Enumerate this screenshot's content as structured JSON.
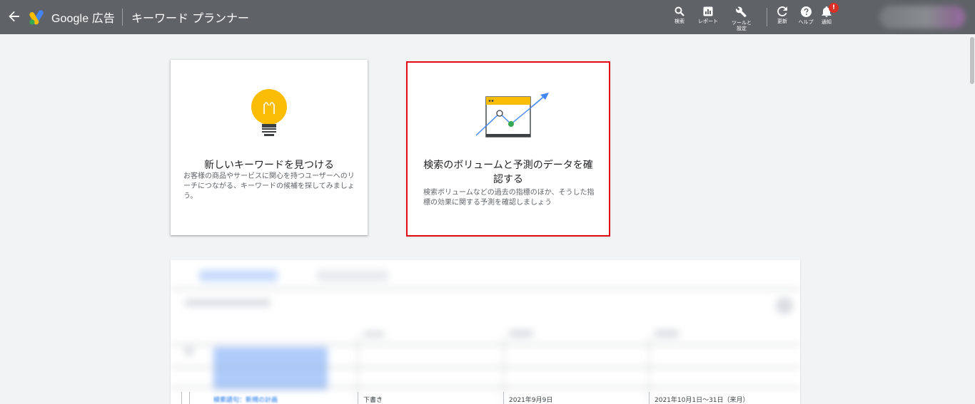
{
  "header": {
    "back_icon": "arrow-left-icon",
    "brand": "Google 広告",
    "page_title": "キーワード プランナー",
    "colors": {
      "bar": "#5f6368",
      "badge": "#d93025"
    },
    "tools": [
      {
        "label": "検索",
        "icon": "search-icon"
      },
      {
        "label": "レポート",
        "icon": "report-icon"
      },
      {
        "label": "ツールと\n設定",
        "icon": "wrench-icon"
      },
      {
        "label": "更新",
        "icon": "refresh-icon"
      },
      {
        "label": "ヘルプ",
        "icon": "help-icon"
      },
      {
        "label": "通知",
        "icon": "bell-icon",
        "badge": "!"
      }
    ]
  },
  "cards": [
    {
      "title": "新しいキーワードを見つける",
      "description": "お客様の商品やサービスに関心を持つユーザーへのリーチにつながる、キーワードの候補を探してみましょう。",
      "icon": "lightbulb-icon"
    },
    {
      "title": "検索のボリュームと予測のデータを確認する",
      "description": "検索ボリュームなどの過去の指標のほか、そうした指標の効果に関する予測を確認しましょう",
      "icon": "forecast-chart-icon",
      "highlight_color": "#e50914"
    }
  ],
  "plans_table": {
    "row": {
      "col1": "検索語句：新規の計画",
      "col2": "下書き",
      "col3": "2021年9月9日",
      "col4": "2021年10月1日～31日（来月）"
    }
  }
}
